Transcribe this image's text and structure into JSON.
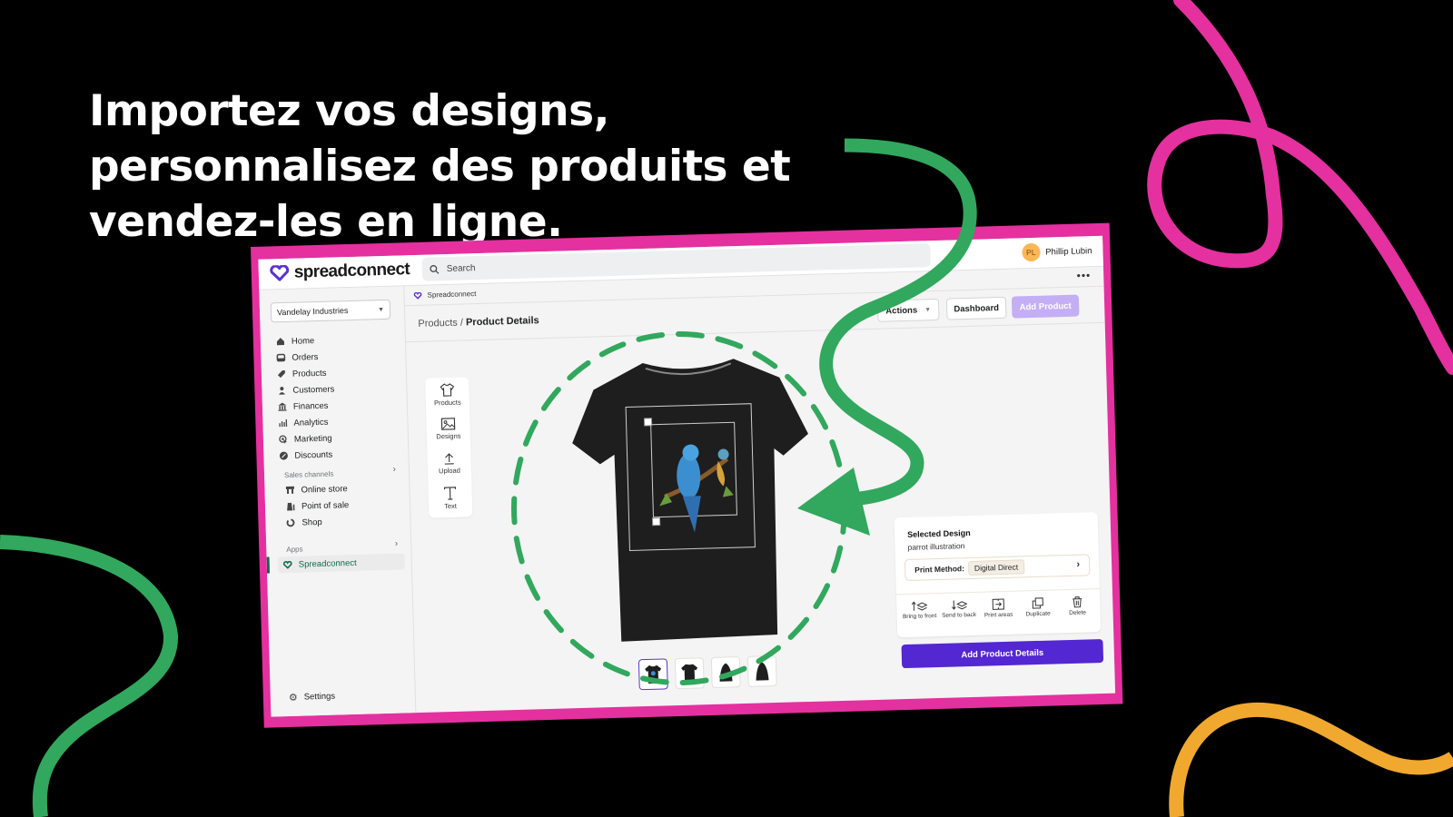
{
  "headline": {
    "lines": [
      "Importez vos designs,",
      "personnalisez des produits et",
      "vendez-les en ligne."
    ]
  },
  "colors": {
    "background": "#000000",
    "frame_pink": "#e5309f",
    "swoosh_green": "#31a85d",
    "swoosh_orange": "#f0a92e",
    "brand_purple": "#5327d2",
    "disabled_purple": "#c4aef4"
  },
  "app": {
    "brand": "spreadconnect",
    "search": {
      "placeholder": "Search",
      "icon": "search-icon"
    },
    "user": {
      "initials": "PL",
      "name": "Phillip Lubin"
    },
    "more_label": "•••",
    "store_selector": "Vandelay Industries",
    "nav": [
      {
        "label": "Home",
        "icon": "home-icon"
      },
      {
        "label": "Orders",
        "icon": "orders-icon"
      },
      {
        "label": "Products",
        "icon": "tag-icon"
      },
      {
        "label": "Customers",
        "icon": "person-icon"
      },
      {
        "label": "Finances",
        "icon": "bank-icon"
      },
      {
        "label": "Analytics",
        "icon": "bar-chart-icon"
      },
      {
        "label": "Marketing",
        "icon": "target-icon"
      },
      {
        "label": "Discounts",
        "icon": "discount-icon"
      }
    ],
    "sales_channels": {
      "title": "Sales channels",
      "items": [
        {
          "label": "Online store",
          "icon": "store-icon"
        },
        {
          "label": "Point of sale",
          "icon": "pos-icon"
        },
        {
          "label": "Shop",
          "icon": "shop-icon"
        }
      ]
    },
    "apps": {
      "title": "Apps",
      "active": "Spreadconnect"
    },
    "settings_label": "Settings",
    "app_header": "Spreadconnect",
    "breadcrumb": {
      "parent": "Products",
      "separator": " / ",
      "current": "Product Details"
    },
    "buttons": {
      "actions": "Actions",
      "dashboard": "Dashboard",
      "add_product": "Add Product"
    },
    "tools": [
      {
        "label": "Products",
        "icon": "tshirt-icon"
      },
      {
        "label": "Designs",
        "icon": "image-icon"
      },
      {
        "label": "Upload",
        "icon": "upload-icon"
      },
      {
        "label": "Text",
        "icon": "text-icon"
      }
    ],
    "thumbnails": [
      "front",
      "back",
      "left-sleeve",
      "right-sleeve"
    ],
    "selected_design": {
      "title": "Selected Design",
      "name": "parrot illustration",
      "print_method_label": "Print Method:",
      "print_method_value": "Digital Direct"
    },
    "design_actions": [
      {
        "label": "Bring to front",
        "icon": "bring-front-icon"
      },
      {
        "label": "Send to back",
        "icon": "send-back-icon"
      },
      {
        "label": "Print areas",
        "icon": "print-areas-icon"
      },
      {
        "label": "Duplicate",
        "icon": "duplicate-icon"
      },
      {
        "label": "Delete",
        "icon": "trash-icon"
      }
    ],
    "cta": "Add Product Details"
  }
}
